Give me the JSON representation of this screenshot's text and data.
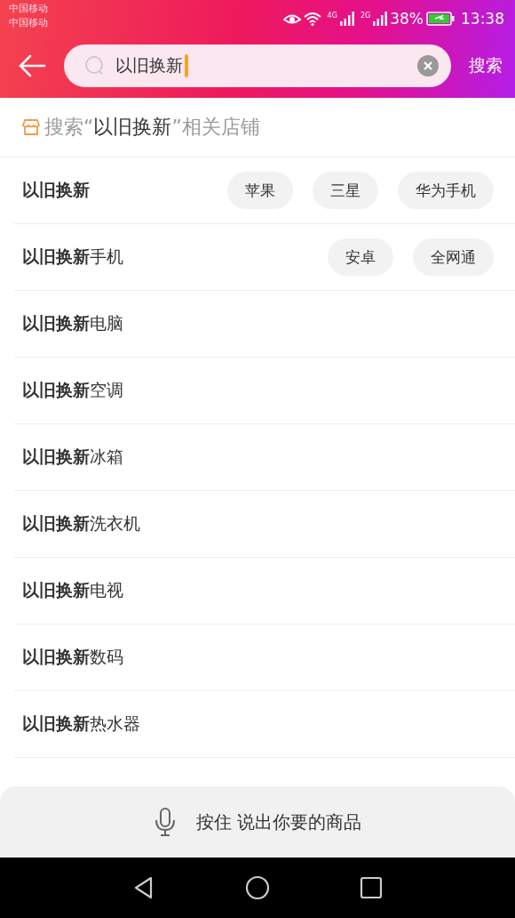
{
  "status_bar": {
    "carriers": [
      "中国移动",
      "中国移动"
    ],
    "networks": [
      "4G",
      "2G"
    ],
    "battery": "38%",
    "time": "13:38"
  },
  "search": {
    "value": "以旧换新",
    "button": "搜索"
  },
  "store_hint": "搜索“**以旧换新**”相关店铺",
  "suggestions": [
    {
      "text": "**以旧换新**",
      "tags": [
        "苹果",
        "三星",
        "华为手机"
      ]
    },
    {
      "text": "**以旧换新**手机",
      "tags": [
        "安卓",
        "全网通"
      ]
    },
    {
      "text": "**以旧换新**电脑"
    },
    {
      "text": "**以旧换新**空调"
    },
    {
      "text": "**以旧换新**冰箱"
    },
    {
      "text": "**以旧换新**洗衣机"
    },
    {
      "text": "**以旧换新**电视"
    },
    {
      "text": "**以旧换新**数码"
    },
    {
      "text": "**以旧换新**热水器"
    }
  ],
  "voice_bar": "按住 说出你要的商品"
}
